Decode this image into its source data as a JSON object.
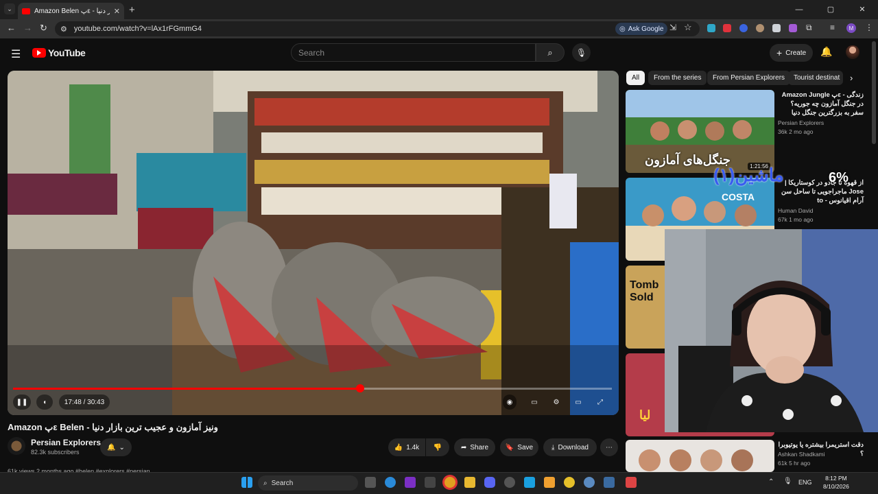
{
  "browser": {
    "tab_title": "Amazon Belen پε - بازار دنیا",
    "url": "youtube.com/watch?v=lAx1rFGmmG4",
    "ask_google": "Ask Google",
    "profile_letter": "M"
  },
  "youtube": {
    "logo_text": "YouTube",
    "search_placeholder": "Search",
    "create_label": "Create"
  },
  "player": {
    "time": "17:48 / 30:43",
    "progress_fraction": 0.58
  },
  "video": {
    "title": "Amazon پε Belen - ونیز آمازون و عجیب ترین بازار دنیا",
    "channel": "Persian Explorers",
    "subscribers": "82.3k subscribers",
    "likes": "1.4k",
    "share": "Share",
    "save": "Save",
    "download": "Download",
    "meta": "61k views  2 months ago  #belen #explorers #persian"
  },
  "chips": [
    "All",
    "From the series",
    "From Persian Explorers",
    "Tourist destinat"
  ],
  "recommendations": [
    {
      "title": "Amazon Jungle پε - زندگی در جنگل آمازون چه جوریه؟ سفر به بزرگترین جنگل دنیا",
      "channel": "Persian Explorers",
      "meta": "36k  2 mo ago",
      "duration": "1:21:56",
      "overlay": "جنگل‌های آمازون"
    },
    {
      "title": "از قهوه تا جادو در کوستاریکا | ماجراجویی تا ساحل سن Jose to - آرام اقیانوس",
      "channel": "Human David",
      "meta": "67k  1 mo ago",
      "overlay": "COSTA"
    },
    {
      "title": "",
      "channel": "",
      "meta": "",
      "overlay": "Tomb Sold"
    },
    {
      "title": "",
      "channel": "",
      "meta": "",
      "overlay": "لیا"
    },
    {
      "title": "دقت استریمرا بیشتره یا یوتیوبرا ؟",
      "channel": "Ashkan Shadkami",
      "meta": "61k  5 hr ago"
    }
  ],
  "stream_overlay": {
    "percent": "6%",
    "text": "ماشین(۱)"
  },
  "taskbar": {
    "search": "Search",
    "lang": "ENG",
    "time": "8:12 PM",
    "date": "8/10/2026"
  }
}
